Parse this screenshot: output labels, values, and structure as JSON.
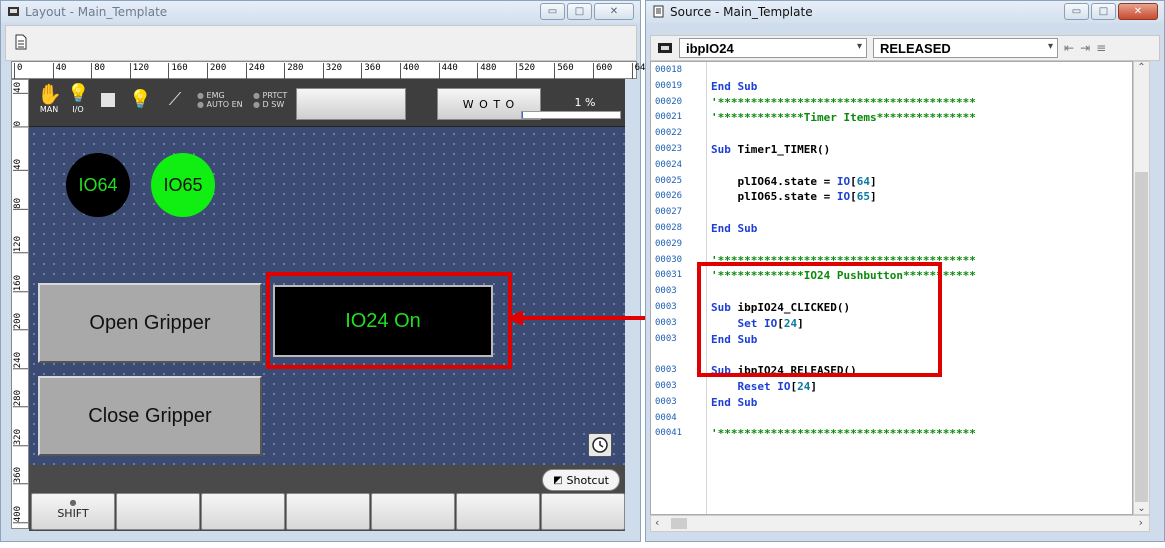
{
  "layout_window": {
    "title": "Layout - Main_Template",
    "ruler_h": [
      "0",
      "40",
      "80",
      "120",
      "160",
      "200",
      "240",
      "280",
      "320",
      "360",
      "400",
      "440",
      "480",
      "520",
      "560",
      "600",
      "64"
    ],
    "ruler_v": [
      "40",
      "0",
      "40",
      "80",
      "120",
      "160",
      "200",
      "240",
      "280",
      "320",
      "360",
      "400"
    ],
    "toolbar_icons": {
      "man": "MAN",
      "io": "I/O",
      "emg": "EMG",
      "prtct": "PRTCT",
      "autoen": "AUTO EN",
      "dsw": "D SW"
    },
    "woto_label": "W O T O",
    "progress_text": "1 %",
    "progress_value": 0.01,
    "lamps": [
      {
        "label": "IO64",
        "bg": "#000000",
        "fg": "#22dd22"
      },
      {
        "label": "IO65",
        "bg": "#11ee11",
        "fg": "#111111"
      }
    ],
    "open_gripper_label": "Open Gripper",
    "close_gripper_label": "Close Gripper",
    "io24_label": "IO24 On",
    "shortcut_label": "Shotcut",
    "shift_label": "SHIFT"
  },
  "source_window": {
    "title": "Source - Main_Template",
    "object_combo": "ibpIO24",
    "event_combo": "RELEASED",
    "code_lines": [
      {
        "num": "00018",
        "text": ""
      },
      {
        "num": "00019",
        "text": "End Sub"
      },
      {
        "num": "00020",
        "text": "'***************************************"
      },
      {
        "num": "00021",
        "text": "'*************Timer Items***************"
      },
      {
        "num": "00022",
        "text": ""
      },
      {
        "num": "00023",
        "text": "Sub Timer1_TIMER()"
      },
      {
        "num": "00024",
        "text": ""
      },
      {
        "num": "00025",
        "text": "    plIO64.state = IO[64]"
      },
      {
        "num": "00026",
        "text": "    plIO65.state = IO[65]"
      },
      {
        "num": "00027",
        "text": ""
      },
      {
        "num": "00028",
        "text": "End Sub"
      },
      {
        "num": "00029",
        "text": ""
      },
      {
        "num": "00030",
        "text": "'***************************************"
      },
      {
        "num": "00031",
        "text": "'*************IO24 Pushbutton***********"
      },
      {
        "num": "0003",
        "text": ""
      },
      {
        "num": "0003",
        "text": "Sub ibpIO24_CLICKED()"
      },
      {
        "num": "0003",
        "text": "    Set IO[24]"
      },
      {
        "num": "0003",
        "text": "End Sub"
      },
      {
        "num": "",
        "text": ""
      },
      {
        "num": "0003",
        "text": "Sub ibpIO24_RELEASED()"
      },
      {
        "num": "0003",
        "text": "    Reset IO[24]"
      },
      {
        "num": "0003",
        "text": "End Sub"
      },
      {
        "num": "0004",
        "text": ""
      },
      {
        "num": "00041",
        "text": "'***************************************"
      }
    ]
  },
  "colors": {
    "highlight": "#e10000",
    "canvas": "#3c4b73"
  }
}
